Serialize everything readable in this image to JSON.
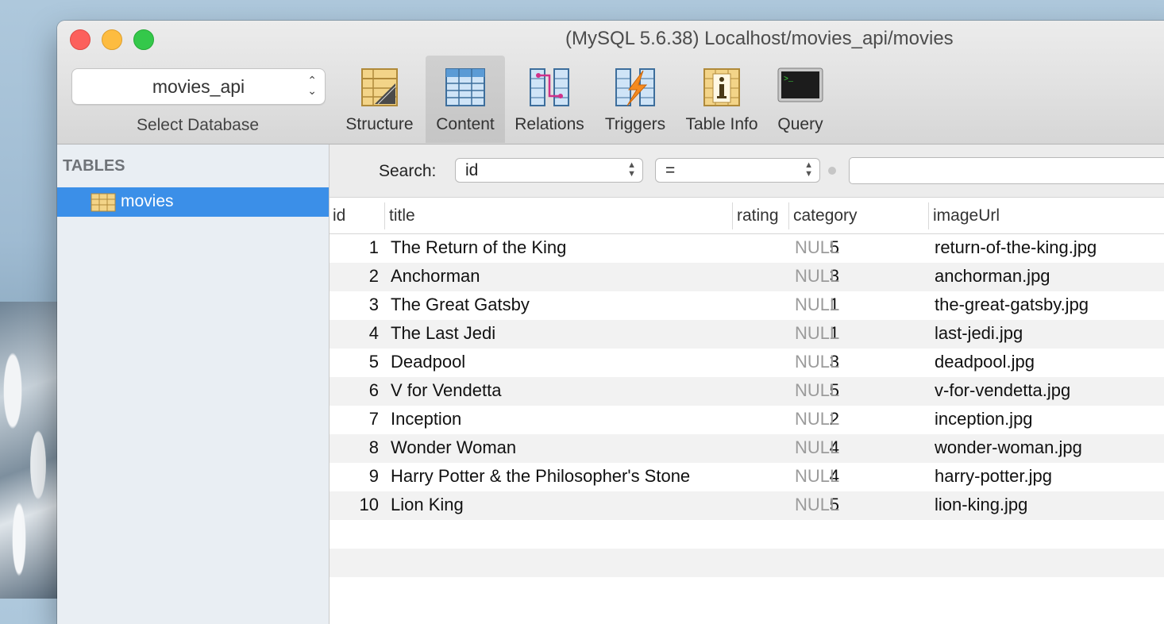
{
  "window": {
    "title": "(MySQL 5.6.38) Localhost/movies_api/movies"
  },
  "database": {
    "selected": "movies_api",
    "caption": "Select Database"
  },
  "toolbar": {
    "structure": "Structure",
    "content": "Content",
    "relations": "Relations",
    "triggers": "Triggers",
    "table_info": "Table Info",
    "query": "Query"
  },
  "sidebar": {
    "header": "TABLES",
    "items": [
      {
        "label": "movies",
        "selected": true
      }
    ]
  },
  "search": {
    "label": "Search:",
    "field": "id",
    "operator": "=",
    "value": ""
  },
  "table": {
    "columns": [
      "id",
      "title",
      "rating",
      "category",
      "imageUrl"
    ],
    "rows": [
      {
        "id": "1",
        "title": "The Return of the King",
        "rating": "5",
        "category": "NULL",
        "imageUrl": "return-of-the-king.jpg"
      },
      {
        "id": "2",
        "title": "Anchorman",
        "rating": "3",
        "category": "NULL",
        "imageUrl": "anchorman.jpg"
      },
      {
        "id": "3",
        "title": "The Great Gatsby",
        "rating": "1",
        "category": "NULL",
        "imageUrl": "the-great-gatsby.jpg"
      },
      {
        "id": "4",
        "title": "The Last Jedi",
        "rating": "1",
        "category": "NULL",
        "imageUrl": "last-jedi.jpg"
      },
      {
        "id": "5",
        "title": "Deadpool",
        "rating": "3",
        "category": "NULL",
        "imageUrl": "deadpool.jpg"
      },
      {
        "id": "6",
        "title": "V for Vendetta",
        "rating": "5",
        "category": "NULL",
        "imageUrl": "v-for-vendetta.jpg"
      },
      {
        "id": "7",
        "title": "Inception",
        "rating": "2",
        "category": "NULL",
        "imageUrl": "inception.jpg"
      },
      {
        "id": "8",
        "title": "Wonder Woman",
        "rating": "4",
        "category": "NULL",
        "imageUrl": "wonder-woman.jpg"
      },
      {
        "id": "9",
        "title": "Harry Potter & the Philosopher's Stone",
        "rating": "4",
        "category": "NULL",
        "imageUrl": "harry-potter.jpg"
      },
      {
        "id": "10",
        "title": "Lion King",
        "rating": "5",
        "category": "NULL",
        "imageUrl": "lion-king.jpg"
      }
    ]
  },
  "colors": {
    "selection": "#3b8fe8",
    "null_text": "#9b9b9b"
  }
}
